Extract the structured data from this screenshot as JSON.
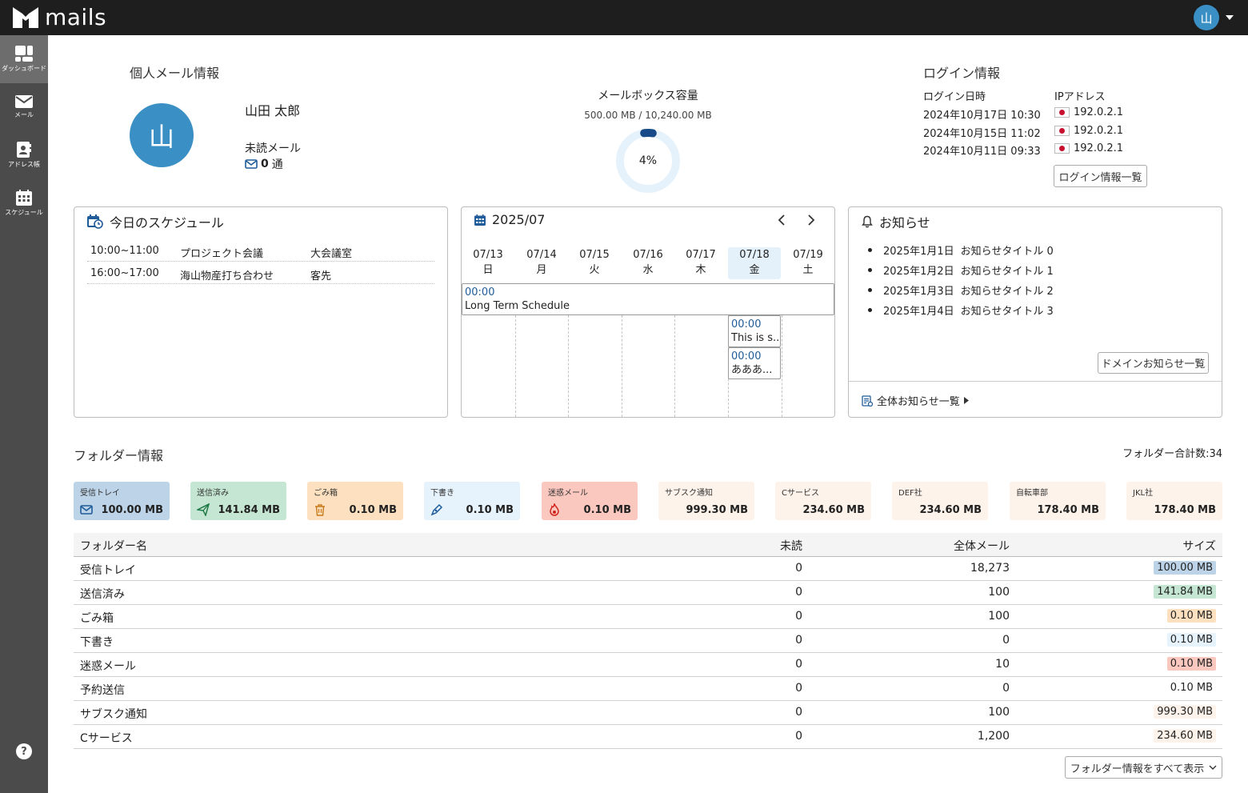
{
  "app": {
    "logo_text": "mails",
    "user_initial": "山"
  },
  "sidebar": {
    "items": [
      {
        "label": "ダッシュボード",
        "icon": "dashboard-icon"
      },
      {
        "label": "メール",
        "icon": "mail-icon"
      },
      {
        "label": "アドレス帳",
        "icon": "address-book-icon"
      },
      {
        "label": "スケジュール",
        "icon": "calendar-icon"
      }
    ],
    "help": "?"
  },
  "personal": {
    "title": "個人メール情報",
    "avatar": "山",
    "name": "山田 太郎",
    "unread_label": "未読メール",
    "unread_count": "0",
    "unread_unit": "通"
  },
  "mailbox": {
    "title": "メールボックス容量",
    "usage": "500.00 MB / 10,240.00 MB",
    "percent_label": "4%",
    "percent": 4.9
  },
  "login": {
    "title": "ログイン情報",
    "date_header": "ログイン日時",
    "ip_header": "IPアドレス",
    "rows": [
      {
        "date": "2024年10月17日 10:30",
        "ip": "192.0.2.1"
      },
      {
        "date": "2024年10月15日 11:02",
        "ip": "192.0.2.1"
      },
      {
        "date": "2024年10月11日 09:33",
        "ip": "192.0.2.1"
      }
    ],
    "button": "ログイン情報一覧"
  },
  "schedule": {
    "title": "今日のスケジュール",
    "rows": [
      {
        "time": "10:00~11:00",
        "name": "プロジェクト会議",
        "place": "大会議室"
      },
      {
        "time": "16:00~17:00",
        "name": "海山物産打ち合わせ",
        "place": "客先"
      }
    ]
  },
  "calendar": {
    "month": "2025/07",
    "days": [
      {
        "date": "07/13",
        "dow": "日"
      },
      {
        "date": "07/14",
        "dow": "月"
      },
      {
        "date": "07/15",
        "dow": "火"
      },
      {
        "date": "07/16",
        "dow": "水"
      },
      {
        "date": "07/17",
        "dow": "木"
      },
      {
        "date": "07/18",
        "dow": "金"
      },
      {
        "date": "07/19",
        "dow": "土"
      }
    ],
    "long_event": {
      "time": "00:00",
      "title": "Long Term Schedule"
    },
    "events": [
      {
        "time": "00:00",
        "title": "This is s..."
      },
      {
        "time": "00:00",
        "title": "あああ..."
      }
    ]
  },
  "notices": {
    "title": "お知らせ",
    "items": [
      {
        "date": "2025年1月1日",
        "title": "お知らせタイトル 0"
      },
      {
        "date": "2025年1月2日",
        "title": "お知らせタイトル 1"
      },
      {
        "date": "2025年1月3日",
        "title": "お知らせタイトル 2"
      },
      {
        "date": "2025年1月4日",
        "title": "お知らせタイトル 3"
      }
    ],
    "domain_button": "ドメインお知らせ一覧",
    "all_link": "全体お知らせ一覧"
  },
  "folders": {
    "title": "フォルダー情報",
    "total_label": "フォルダー合計数:34",
    "tiles": [
      {
        "label": "受信トレイ",
        "size": "100.00 MB",
        "color": "#bcd3e8",
        "icon": "inbox-icon"
      },
      {
        "label": "送信済み",
        "size": "141.84 MB",
        "color": "#c4e6d2",
        "icon": "send-icon"
      },
      {
        "label": "ごみ箱",
        "size": "0.10 MB",
        "color": "#fde0bf",
        "icon": "trash-icon"
      },
      {
        "label": "下書き",
        "size": "0.10 MB",
        "color": "#e6f3fc",
        "icon": "pen-icon"
      },
      {
        "label": "迷惑メール",
        "size": "0.10 MB",
        "color": "#fbc8bf",
        "icon": "spam-icon"
      },
      {
        "label": "サブスク通知",
        "size": "999.30 MB",
        "color": "#fdf3ea",
        "icon": ""
      },
      {
        "label": "Cサービス",
        "size": "234.60 MB",
        "color": "#fdf3ea",
        "icon": ""
      },
      {
        "label": "DEF社",
        "size": "234.60 MB",
        "color": "#fdf3ea",
        "icon": ""
      },
      {
        "label": "自転車部",
        "size": "178.40 MB",
        "color": "#fdf3ea",
        "icon": ""
      },
      {
        "label": "JKL社",
        "size": "178.40 MB",
        "color": "#fdf3ea",
        "icon": ""
      }
    ],
    "table": {
      "headers": {
        "name": "フォルダー名",
        "unread": "未読",
        "total": "全体メール",
        "size": "サイズ"
      },
      "rows": [
        {
          "name": "受信トレイ",
          "unread": "0",
          "total": "18,273",
          "size": "100.00 MB",
          "color": "#bcd3e8"
        },
        {
          "name": "送信済み",
          "unread": "0",
          "total": "100",
          "size": "141.84 MB",
          "color": "#c4e6d2"
        },
        {
          "name": "ごみ箱",
          "unread": "0",
          "total": "100",
          "size": "0.10 MB",
          "color": "#fde0bf"
        },
        {
          "name": "下書き",
          "unread": "0",
          "total": "0",
          "size": "0.10 MB",
          "color": "#e6f3fc"
        },
        {
          "name": "迷惑メール",
          "unread": "0",
          "total": "10",
          "size": "0.10 MB",
          "color": "#fbc8bf"
        },
        {
          "name": "予約送信",
          "unread": "0",
          "total": "0",
          "size": "0.10 MB",
          "color": "#ffffff"
        },
        {
          "name": "サブスク通知",
          "unread": "0",
          "total": "100",
          "size": "999.30 MB",
          "color": "#fdf3ea"
        },
        {
          "name": "Cサービス",
          "unread": "0",
          "total": "1,200",
          "size": "234.60 MB",
          "color": "#fdf3ea"
        }
      ]
    },
    "show_all_button": "フォルダー情報をすべて表示"
  }
}
